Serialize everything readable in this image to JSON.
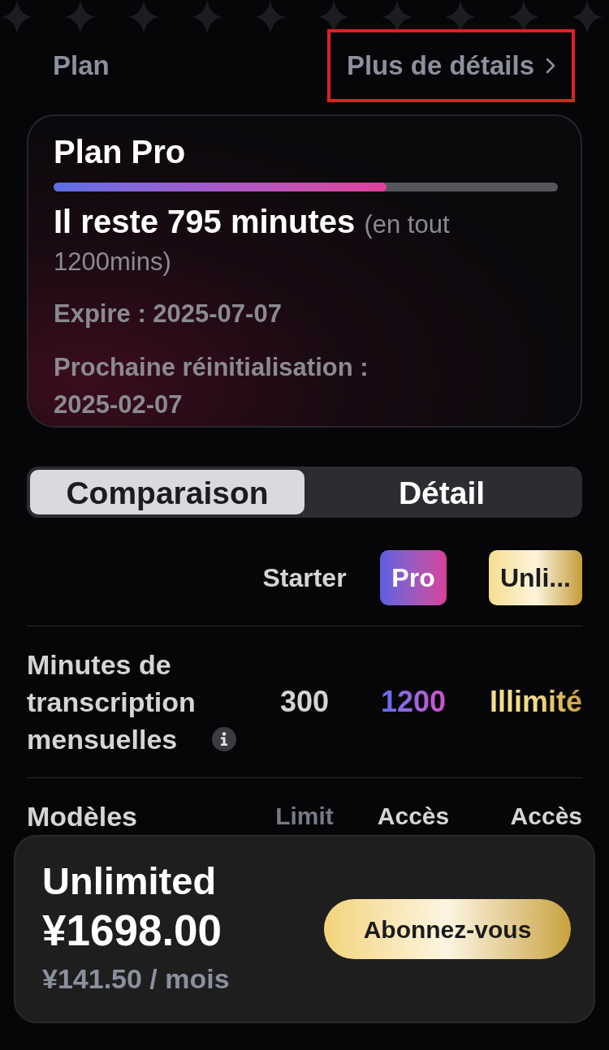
{
  "header": {
    "title": "Plan",
    "details_link": {
      "label": "Plus de détails",
      "highlighted": true
    }
  },
  "plan_card": {
    "name": "Plan Pro",
    "level": 0.66,
    "remaining": "Il reste 795 minutes",
    "total": "(en tout 1200mins)",
    "expiry": "Expire : 2025-07-07",
    "reset": "Prochaine réinitialisation : 2025-02-07"
  },
  "segments": [
    {
      "label": "Comparaison",
      "selected": true
    },
    {
      "label": "Détail",
      "selected": false
    }
  ],
  "comparison": {
    "columns": [
      {
        "label": "Starter",
        "kind": "plain"
      },
      {
        "label": "Pro",
        "kind": "pro"
      },
      {
        "label": "Unli...",
        "kind": "unlimited"
      }
    ],
    "rows": [
      {
        "label": "Minutes de transcription mensuelles",
        "info": true,
        "values": [
          {
            "text": "300",
            "kind": "plain"
          },
          {
            "text": "1200",
            "kind": "pro"
          },
          {
            "text": "Illimité",
            "kind": "gold"
          }
        ]
      },
      {
        "label": "Modèles",
        "info": false,
        "values": [
          {
            "text": "Limit",
            "kind": "dim"
          },
          {
            "text": "Accès",
            "kind": "plain"
          },
          {
            "text": "Accès",
            "kind": "plain"
          }
        ]
      }
    ]
  },
  "offer": {
    "plan": "Unlimited",
    "price": "¥1698.00",
    "monthly": "¥141.50 / mois",
    "button": "Abonnez-vous"
  }
}
